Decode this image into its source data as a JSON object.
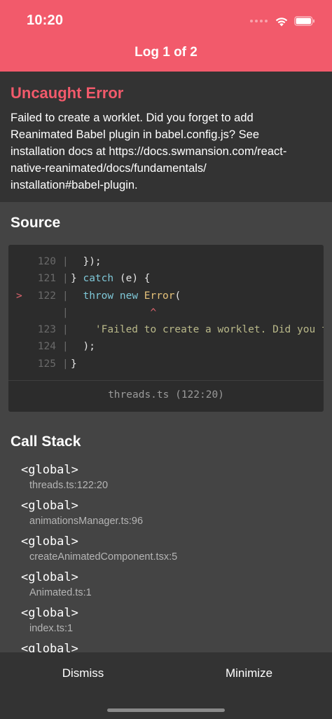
{
  "status_bar": {
    "time": "10:20"
  },
  "header": {
    "title": "Log 1 of 2",
    "color": "#f25a6b"
  },
  "error": {
    "title": "Uncaught Error",
    "message": "Failed to create a worklet. Did you forget to add\nReanimated Babel plugin in babel.config.js? See\ninstallation docs at https://docs.swmansion.com/react-\nnative-reanimated/docs/fundamentals/\ninstallation#babel-plugin."
  },
  "source": {
    "title": "Source",
    "file": "threads.ts (122:20)",
    "lines": [
      {
        "marker": "",
        "number": "120",
        "code": "  });"
      },
      {
        "marker": "",
        "number": "121",
        "code": "} catch (e) {"
      },
      {
        "marker": ">",
        "number": "122",
        "code": "  throw new Error("
      },
      {
        "marker": "",
        "number": "",
        "code": "             ^"
      },
      {
        "marker": "",
        "number": "123",
        "code": "    'Failed to create a worklet. Did you f"
      },
      {
        "marker": "",
        "number": "124",
        "code": "  );"
      },
      {
        "marker": "",
        "number": "125",
        "code": "}"
      }
    ]
  },
  "call_stack": {
    "title": "Call Stack",
    "items": [
      {
        "fn": "<global>",
        "file": "threads.ts:122:20"
      },
      {
        "fn": "<global>",
        "file": "animationsManager.ts:96"
      },
      {
        "fn": "<global>",
        "file": "createAnimatedComponent.tsx:5"
      },
      {
        "fn": "<global>",
        "file": "Animated.ts:1"
      },
      {
        "fn": "<global>",
        "file": "index.ts:1"
      },
      {
        "fn": "<global>",
        "file": ""
      }
    ]
  },
  "bottom_bar": {
    "dismiss_label": "Dismiss",
    "minimize_label": "Minimize"
  },
  "icons": [
    "wifi-icon",
    "battery-icon",
    "signal-icon"
  ]
}
